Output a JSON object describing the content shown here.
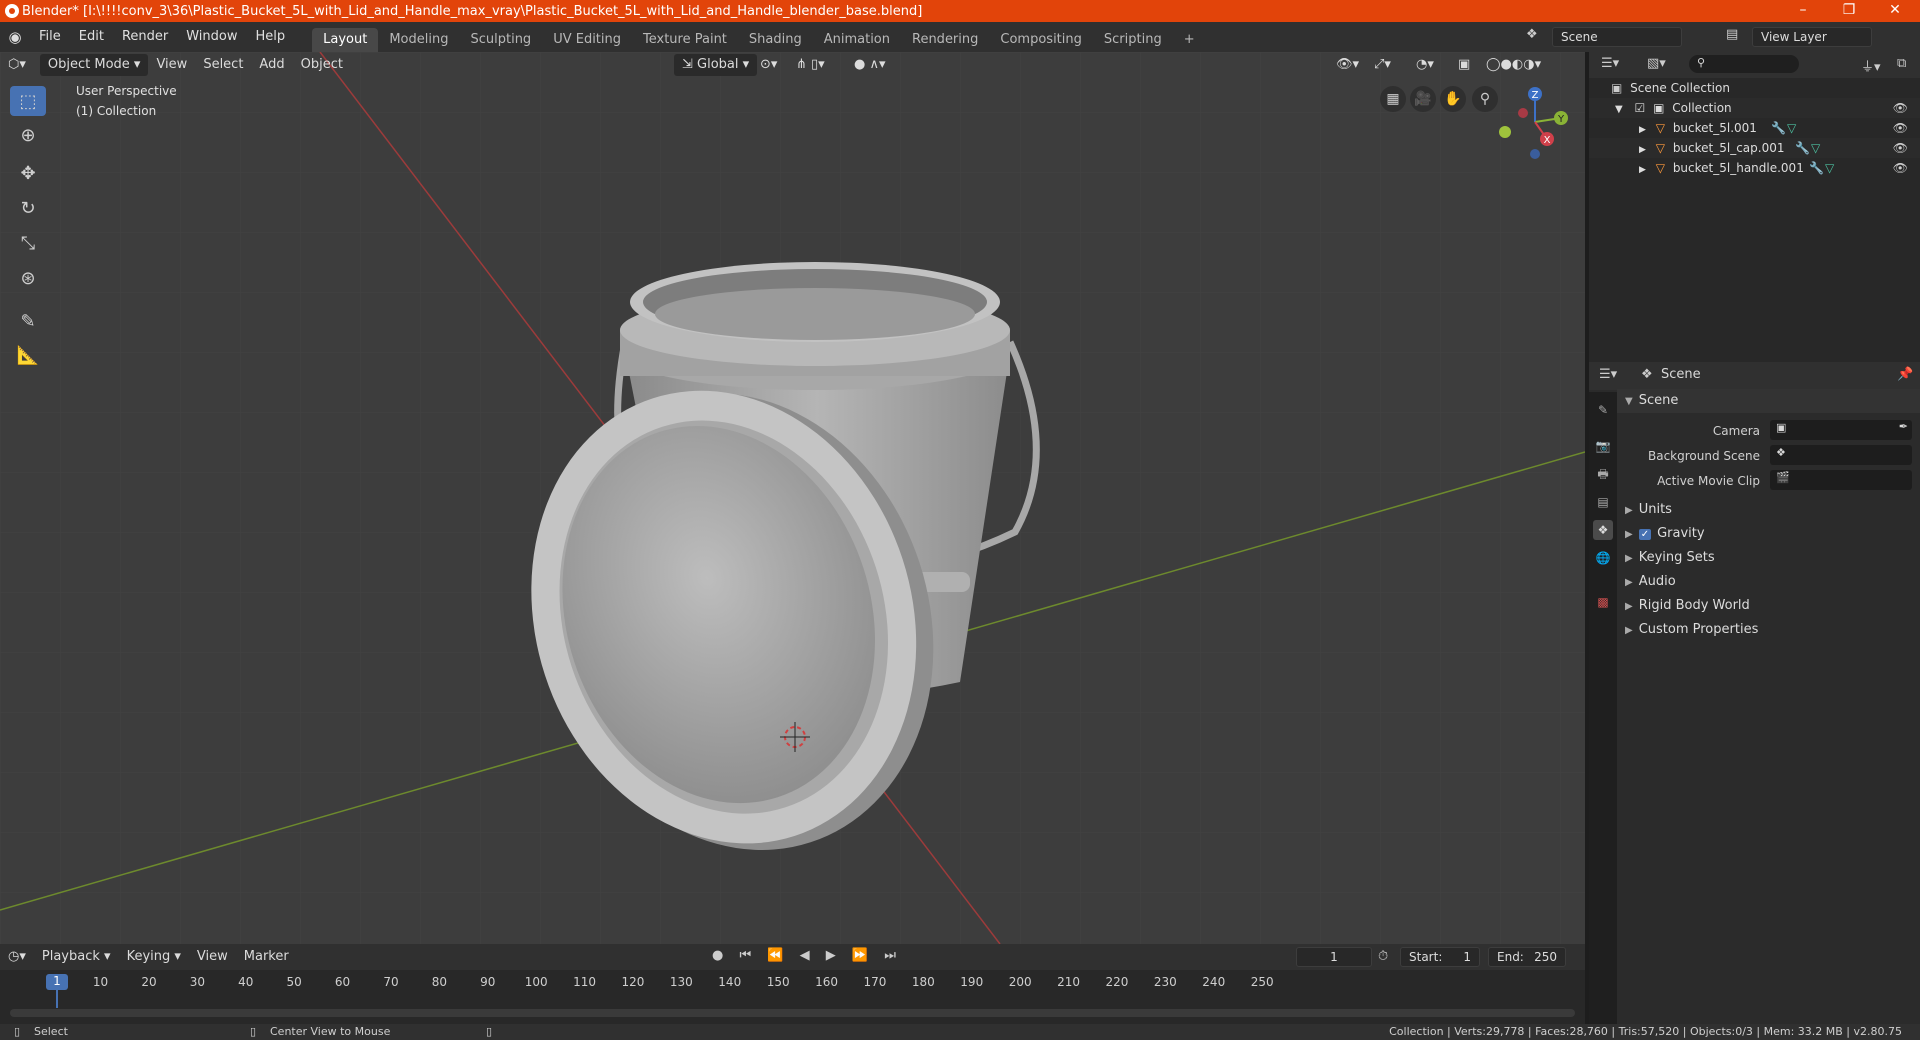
{
  "window": {
    "title": "Blender* [I:\\!!!!conv_3\\36\\Plastic_Bucket_5L_with_Lid_and_Handle_max_vray\\Plastic_Bucket_5L_with_Lid_and_Handle_blender_base.blend]",
    "minimize": "–",
    "maximize": "❐",
    "close": "✕"
  },
  "menubar": {
    "menus": [
      "File",
      "Edit",
      "Render",
      "Window",
      "Help"
    ],
    "workspaces": [
      "Layout",
      "Modeling",
      "Sculpting",
      "UV Editing",
      "Texture Paint",
      "Shading",
      "Animation",
      "Rendering",
      "Compositing",
      "Scripting"
    ],
    "active_workspace": "Layout",
    "add_tab": "+",
    "scene_name": "Scene",
    "view_layer": "View Layer"
  },
  "viewport": {
    "mode": "Object Mode",
    "menus": [
      "View",
      "Select",
      "Add",
      "Object"
    ],
    "orientation": "Global",
    "overlay_title": "User Perspective",
    "overlay_collection": "(1) Collection",
    "gizmo": {
      "x": "X",
      "y": "Y",
      "z": "Z"
    }
  },
  "outliner": {
    "root": "Scene Collection",
    "collection": "Collection",
    "objects": [
      {
        "name": "bucket_5l.001"
      },
      {
        "name": "bucket_5l_cap.001"
      },
      {
        "name": "bucket_5l_handle.001"
      }
    ]
  },
  "properties": {
    "context": "Scene",
    "panel_title": "Scene",
    "fields": [
      {
        "label": "Camera"
      },
      {
        "label": "Background Scene"
      },
      {
        "label": "Active Movie Clip"
      }
    ],
    "subpanels": [
      "Units",
      "Gravity",
      "Keying Sets",
      "Audio",
      "Rigid Body World",
      "Custom Properties"
    ]
  },
  "timeline": {
    "menus": [
      "Playback",
      "Keying",
      "View",
      "Marker"
    ],
    "current_frame": "1",
    "start_label": "Start:",
    "start": "1",
    "end_label": "End:",
    "end": "250",
    "ruler": [
      "10",
      "20",
      "30",
      "40",
      "50",
      "60",
      "70",
      "80",
      "90",
      "100",
      "110",
      "120",
      "130",
      "140",
      "150",
      "160",
      "170",
      "180",
      "190",
      "200",
      "210",
      "220",
      "230",
      "240",
      "250"
    ],
    "playhead": "1"
  },
  "statusbar": {
    "select": "Select",
    "center_view": "Center View to Mouse",
    "stats": "Collection | Verts:29,778 | Faces:28,760 | Tris:57,520 | Objects:0/3 | Mem: 33.2 MB | v2.80.75"
  },
  "colors": {
    "title_bar": "#e2440a",
    "x_axis": "#c8323c",
    "y_axis": "#7fa830",
    "accent": "#4772b3"
  }
}
